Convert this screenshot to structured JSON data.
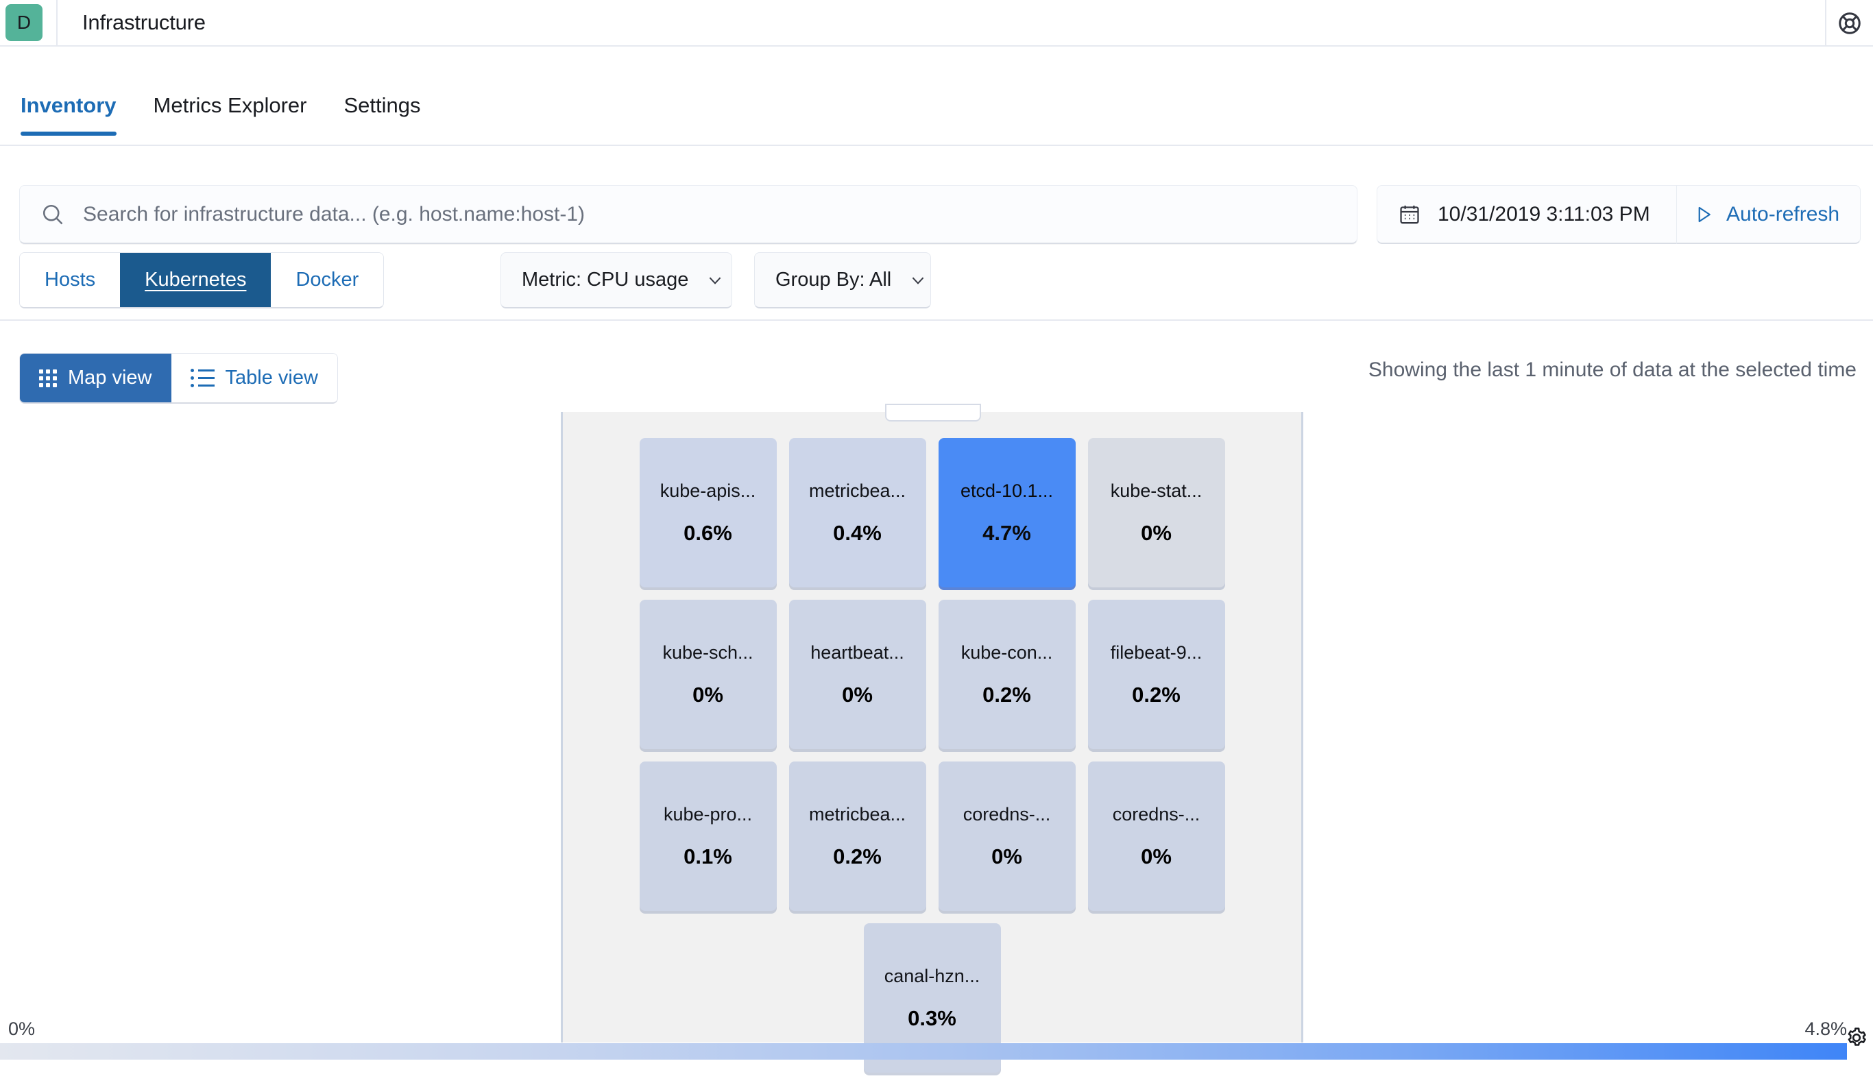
{
  "topbar": {
    "badge_letter": "D",
    "title": "Infrastructure",
    "help_icon": "lifebuoy-icon"
  },
  "tabs": [
    {
      "label": "Inventory",
      "active": true
    },
    {
      "label": "Metrics Explorer",
      "active": false
    },
    {
      "label": "Settings",
      "active": false
    }
  ],
  "search": {
    "icon": "search-icon",
    "placeholder": "Search for infrastructure data... (e.g. host.name:host-1)",
    "value": ""
  },
  "datepicker": {
    "icon": "calendar-icon",
    "value": "10/31/2019 3:11:03 PM"
  },
  "autorefresh": {
    "icon": "play-icon",
    "label": "Auto-refresh"
  },
  "nodetype": {
    "options": [
      {
        "label": "Hosts",
        "active": false
      },
      {
        "label": "Kubernetes",
        "active": true
      },
      {
        "label": "Docker",
        "active": false
      }
    ]
  },
  "metric_dropdown": {
    "label": "Metric: CPU usage",
    "icon": "chevron-down-icon"
  },
  "group_dropdown": {
    "label": "Group By: All",
    "icon": "chevron-down-icon"
  },
  "viewtoggle": {
    "map": {
      "label": "Map view",
      "icon": "grid-dots-icon",
      "active": true
    },
    "table": {
      "label": "Table view",
      "icon": "list-icon",
      "active": false
    }
  },
  "status_text": "Showing the last 1 minute of data at the selected time",
  "legend": {
    "min": "0%",
    "max": "4.8%",
    "gradient_from": "#e3e7ef",
    "gradient_to": "#3f85f7",
    "settings_icon": "gear-icon"
  },
  "chart_data": {
    "type": "treemap",
    "title": "Kubernetes pods CPU usage",
    "metric": "CPU usage",
    "value_unit": "%",
    "color_scale": {
      "min": 0,
      "max": 4.8,
      "from": "#e3e7ef",
      "to": "#3f85f7"
    },
    "rows": [
      [
        {
          "name": "kube-apis...",
          "value": "0.6%",
          "numeric": 0.6,
          "color": "#ccd5e9",
          "highlight": false
        },
        {
          "name": "metricbea...",
          "value": "0.4%",
          "numeric": 0.4,
          "color": "#ccd5e9",
          "highlight": false
        },
        {
          "name": "etcd-10.1...",
          "value": "4.7%",
          "numeric": 4.7,
          "color": "#4a8bf5",
          "highlight": true
        },
        {
          "name": "kube-stat...",
          "value": "0%",
          "numeric": 0.0,
          "color": "#d8dce4",
          "highlight": false
        }
      ],
      [
        {
          "name": "kube-sch...",
          "value": "0%",
          "numeric": 0.0,
          "color": "#cdd5e6",
          "highlight": false
        },
        {
          "name": "heartbeat...",
          "value": "0%",
          "numeric": 0.0,
          "color": "#cdd5e6",
          "highlight": false
        },
        {
          "name": "kube-con...",
          "value": "0.2%",
          "numeric": 0.2,
          "color": "#cdd5e6",
          "highlight": false
        },
        {
          "name": "filebeat-9...",
          "value": "0.2%",
          "numeric": 0.2,
          "color": "#cdd5e6",
          "highlight": false
        }
      ],
      [
        {
          "name": "kube-pro...",
          "value": "0.1%",
          "numeric": 0.1,
          "color": "#ccd4e5",
          "highlight": false
        },
        {
          "name": "metricbea...",
          "value": "0.2%",
          "numeric": 0.2,
          "color": "#ccd4e5",
          "highlight": false
        },
        {
          "name": "coredns-...",
          "value": "0%",
          "numeric": 0.0,
          "color": "#ccd4e5",
          "highlight": false
        },
        {
          "name": "coredns-...",
          "value": "0%",
          "numeric": 0.0,
          "color": "#ccd4e5",
          "highlight": false
        }
      ],
      [
        {
          "name": "canal-hzn...",
          "value": "0.3%",
          "numeric": 0.3,
          "color": "#ccd4e5",
          "highlight": false
        }
      ]
    ]
  }
}
